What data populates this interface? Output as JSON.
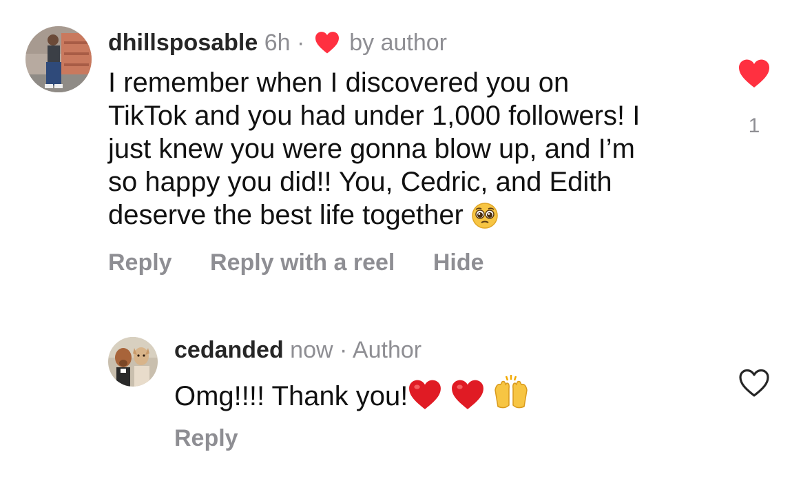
{
  "comment": {
    "username": "dhillsposable",
    "time": "6h",
    "separator": "·",
    "liked_by": "by author",
    "text_lines": [
      "I remember when I discovered you on",
      "TikTok and you had under 1,000 followers! I",
      "just knew you were gonna blow up, and I’m",
      "so happy you did!! You, Cedric, and Edith",
      "deserve the best life together"
    ],
    "emoji": "pleading-face-emoji",
    "actions": {
      "reply": "Reply",
      "reply_reel": "Reply with a reel",
      "hide": "Hide"
    },
    "like_count": "1",
    "liked": true
  },
  "reply": {
    "username": "cedanded",
    "time": "now",
    "separator": "·",
    "badge": "Author",
    "text": "Omg!!!! Thank you!",
    "emojis": [
      "red-heart-emoji",
      "red-heart-emoji",
      "raising-hands-emoji"
    ],
    "actions": {
      "reply": "Reply"
    },
    "liked": false
  },
  "colors": {
    "like_red": "#ff3040",
    "muted_text": "#8e8e93",
    "username_text": "#262626"
  }
}
